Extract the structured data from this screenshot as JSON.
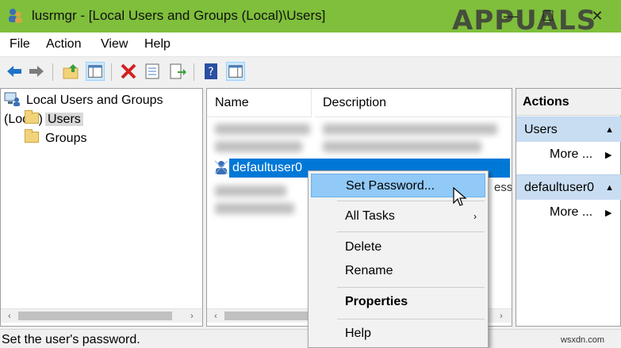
{
  "window": {
    "title": "lusrmgr - [Local Users and Groups (Local)\\Users]",
    "minimize": "—",
    "maximize": "☐",
    "close": "✕",
    "watermark": "APPUALS"
  },
  "menu": [
    "File",
    "Action",
    "View",
    "Help"
  ],
  "toolbar_icons": [
    "back-arrow-icon",
    "forward-arrow-icon",
    "up-folder-icon",
    "show-hide-tree-icon",
    "delete-icon",
    "properties-icon",
    "export-list-icon",
    "help-icon",
    "show-hide-action-pane-icon"
  ],
  "tree": {
    "root": "Local Users and Groups (Local)",
    "items": [
      "Users",
      "Groups"
    ],
    "selected": "Users"
  },
  "list": {
    "columns": [
      "Name",
      "Description"
    ],
    "selected_user": "defaultuser0",
    "partial_description": "ess"
  },
  "actions": {
    "header": "Actions",
    "groups": [
      {
        "title": "Users",
        "more": "More ..."
      },
      {
        "title": "defaultuser0",
        "more": "More ..."
      }
    ]
  },
  "context_menu": {
    "items": [
      "Set Password...",
      "All Tasks",
      "Delete",
      "Rename",
      "Properties",
      "Help"
    ],
    "highlighted": "Set Password...",
    "submenu_arrow": "›"
  },
  "status": "Set the user's password.",
  "footer_watermark": "wsxdn.com",
  "scroll": {
    "left": "‹",
    "right": "›"
  },
  "colors": {
    "titlebar": "#7fbf3b",
    "selection": "#0078d7",
    "menu_highlight": "#91c9f7",
    "actions_group": "#c9ddf2"
  }
}
